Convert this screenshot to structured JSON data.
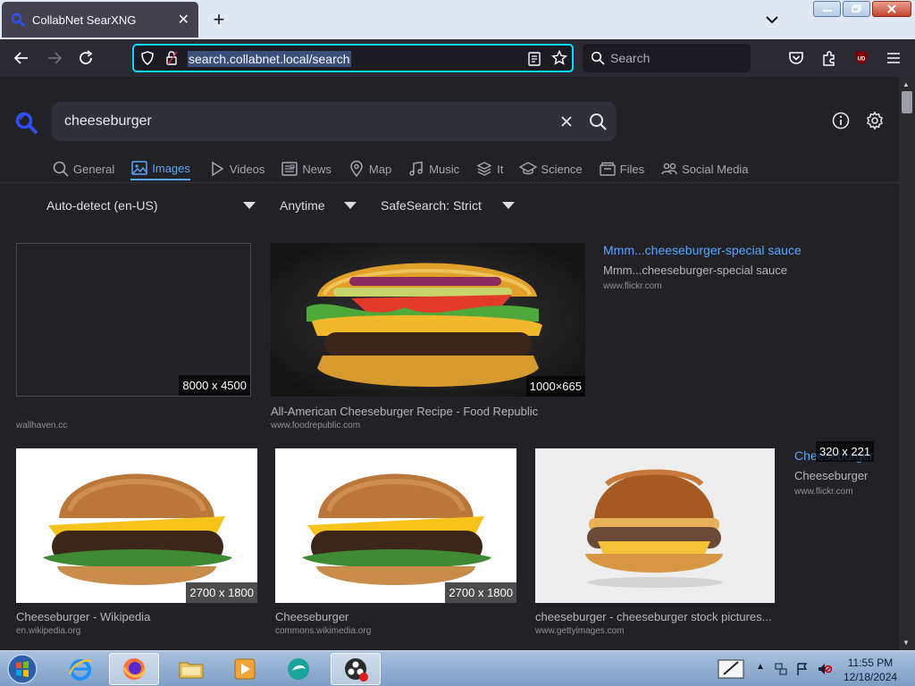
{
  "browser": {
    "tab_title": "CollabNet SearXNG",
    "url": "search.collabnet.local/search",
    "search_placeholder": "Search"
  },
  "search": {
    "query": "cheeseburger"
  },
  "categories": [
    {
      "label": "General",
      "icon": "search-icon",
      "active": false
    },
    {
      "label": "Images",
      "icon": "image-icon",
      "active": true
    },
    {
      "label": "Videos",
      "icon": "play-icon",
      "active": false
    },
    {
      "label": "News",
      "icon": "newspaper-icon",
      "active": false
    },
    {
      "label": "Map",
      "icon": "map-pin-icon",
      "active": false
    },
    {
      "label": "Music",
      "icon": "music-icon",
      "active": false
    },
    {
      "label": "It",
      "icon": "layers-icon",
      "active": false
    },
    {
      "label": "Science",
      "icon": "science-icon",
      "active": false
    },
    {
      "label": "Files",
      "icon": "files-icon",
      "active": false
    },
    {
      "label": "Social Media",
      "icon": "people-icon",
      "active": false
    }
  ],
  "filters": {
    "language": "Auto-detect (en-US)",
    "time": "Anytime",
    "safesearch": "SafeSearch: Strict"
  },
  "results": [
    {
      "title": "",
      "domain": "wallhaven.cc",
      "size": "8000 x 4500"
    },
    {
      "title": "All-American Cheeseburger Recipe - Food Republic",
      "domain": "www.foodrepublic.com",
      "size": "1000×665"
    },
    {
      "title": "Mmm...cheeseburger-special sauce",
      "subtitle": "Mmm...cheeseburger-special sauce",
      "domain": "www.flickr.com"
    },
    {
      "title": "Cheeseburger - Wikipedia",
      "domain": "en.wikipedia.org",
      "size": "2700 x 1800"
    },
    {
      "title": "Cheeseburger",
      "domain": "commons.wikimedia.org",
      "size": "2700 x 1800"
    },
    {
      "title": "cheeseburger - cheeseburger stock pictures...",
      "domain": "www.gettyimages.com"
    },
    {
      "title": "Cheeseburger",
      "subtitle": "Cheeseburger",
      "domain": "www.flickr.com",
      "size": "320 x 221"
    }
  ],
  "taskbar": {
    "time": "11:55 PM",
    "date": "12/18/2024"
  },
  "colors": {
    "accent": "#58a6ff",
    "page_bg": "#222226",
    "chrome_bg": "#2b2a33",
    "url_focus": "#00ddff"
  }
}
